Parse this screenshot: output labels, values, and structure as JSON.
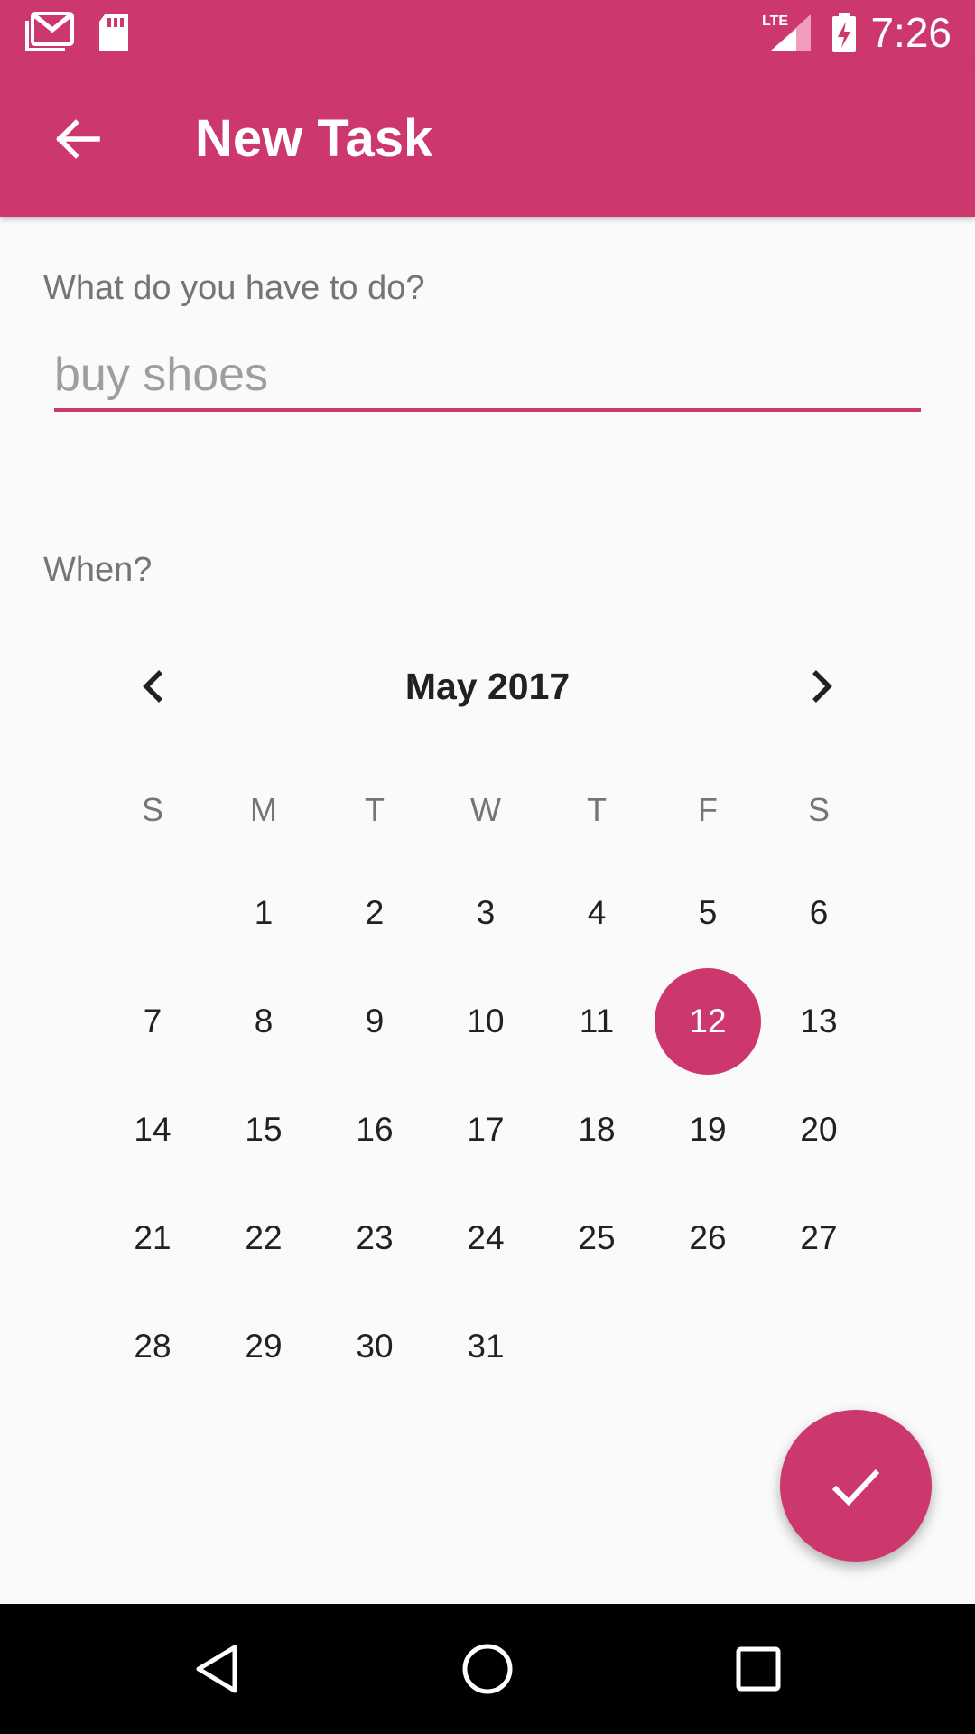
{
  "status_bar": {
    "time": "7:26",
    "icons": [
      "gmail-icon",
      "sd-card-icon",
      "lte-signal-icon",
      "battery-charging-icon"
    ],
    "network_label": "LTE"
  },
  "app_bar": {
    "title": "New Task",
    "back_icon": "arrow-back-icon"
  },
  "task": {
    "label": "What do you have to do?",
    "placeholder": "buy shoes",
    "value": ""
  },
  "when": {
    "label": "When?"
  },
  "calendar": {
    "month_label": "May 2017",
    "weekdays": [
      "S",
      "M",
      "T",
      "W",
      "T",
      "F",
      "S"
    ],
    "weeks": [
      [
        "",
        "1",
        "2",
        "3",
        "4",
        "5",
        "6"
      ],
      [
        "7",
        "8",
        "9",
        "10",
        "11",
        "12",
        "13"
      ],
      [
        "14",
        "15",
        "16",
        "17",
        "18",
        "19",
        "20"
      ],
      [
        "21",
        "22",
        "23",
        "24",
        "25",
        "26",
        "27"
      ],
      [
        "28",
        "29",
        "30",
        "31",
        "",
        "",
        ""
      ]
    ],
    "selected_day": "12",
    "prev_icon": "chevron-left-icon",
    "next_icon": "chevron-right-icon"
  },
  "fab": {
    "icon": "check-icon"
  },
  "nav_bar": {
    "icons": [
      "back-triangle-icon",
      "home-circle-icon",
      "recents-square-icon"
    ]
  },
  "colors": {
    "primary": "#cc376d",
    "background": "#fafafa",
    "text_primary": "#212121",
    "text_secondary": "#757575",
    "hint": "#9e9e9e"
  }
}
